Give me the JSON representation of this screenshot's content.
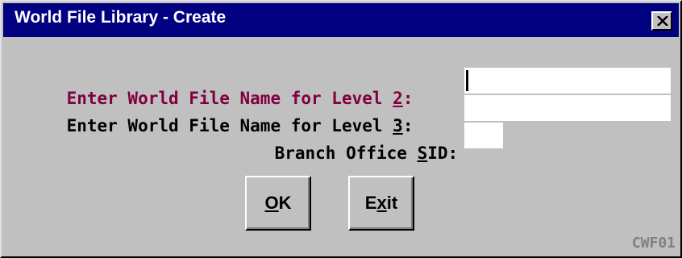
{
  "window": {
    "title": "World File Library  -  Create",
    "close_label": "Close"
  },
  "form": {
    "level2": {
      "label_prefix": "Enter World File Name for Level ",
      "label_key": "2",
      "label_suffix": ":",
      "value": "",
      "label_color": "#800040"
    },
    "level3": {
      "label_prefix": "Enter World File Name for Level ",
      "label_key": "3",
      "label_suffix": ":",
      "value": ""
    },
    "sid": {
      "label_prefix": "Branch Office ",
      "label_key": "S",
      "label_rest": "ID",
      "label_suffix": ":",
      "value": ""
    }
  },
  "buttons": {
    "ok": {
      "key": "O",
      "rest": "K"
    },
    "exit": {
      "pre": "E",
      "key": "x",
      "rest": "it"
    }
  },
  "footer": {
    "code": "CWF01"
  },
  "colors": {
    "titlebar": "#000080",
    "dialog_bg": "#c0c0c0",
    "focus_label": "#800040",
    "footer_text": "#808080"
  }
}
